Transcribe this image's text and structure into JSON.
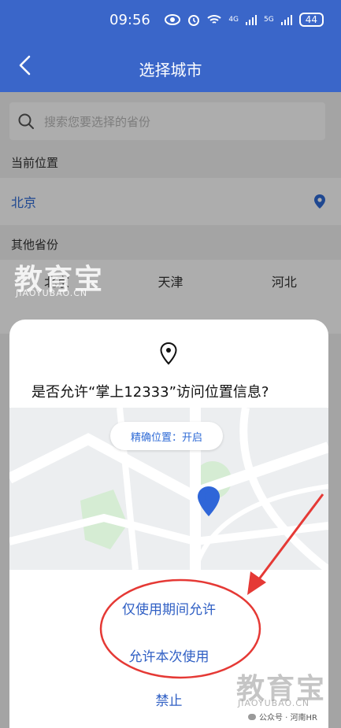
{
  "status_bar": {
    "time": "09:56",
    "network_1": "4G",
    "network_2": "5G",
    "battery": "44"
  },
  "header": {
    "title": "选择城市"
  },
  "search": {
    "placeholder": "搜索您要选择的省份"
  },
  "sections": {
    "current_label": "当前位置",
    "current_city": "北京",
    "other_label": "其他省份"
  },
  "provinces": [
    "北京",
    "天津",
    "河北"
  ],
  "dialog": {
    "title": "是否允许“掌上12333”访问位置信息?",
    "precise_location": "精确位置：开启",
    "options": {
      "while_using": "仅使用期间允许",
      "this_time": "允许本次使用",
      "deny": "禁止"
    }
  },
  "watermark": {
    "brand": "教育宝",
    "domain": "JIAOYUBAO.CN",
    "credit": "公众号 · 河南HR"
  },
  "colors": {
    "header_blue": "#3a66c9",
    "link_blue": "#2f5fc4",
    "annotation_red": "#e53935"
  }
}
